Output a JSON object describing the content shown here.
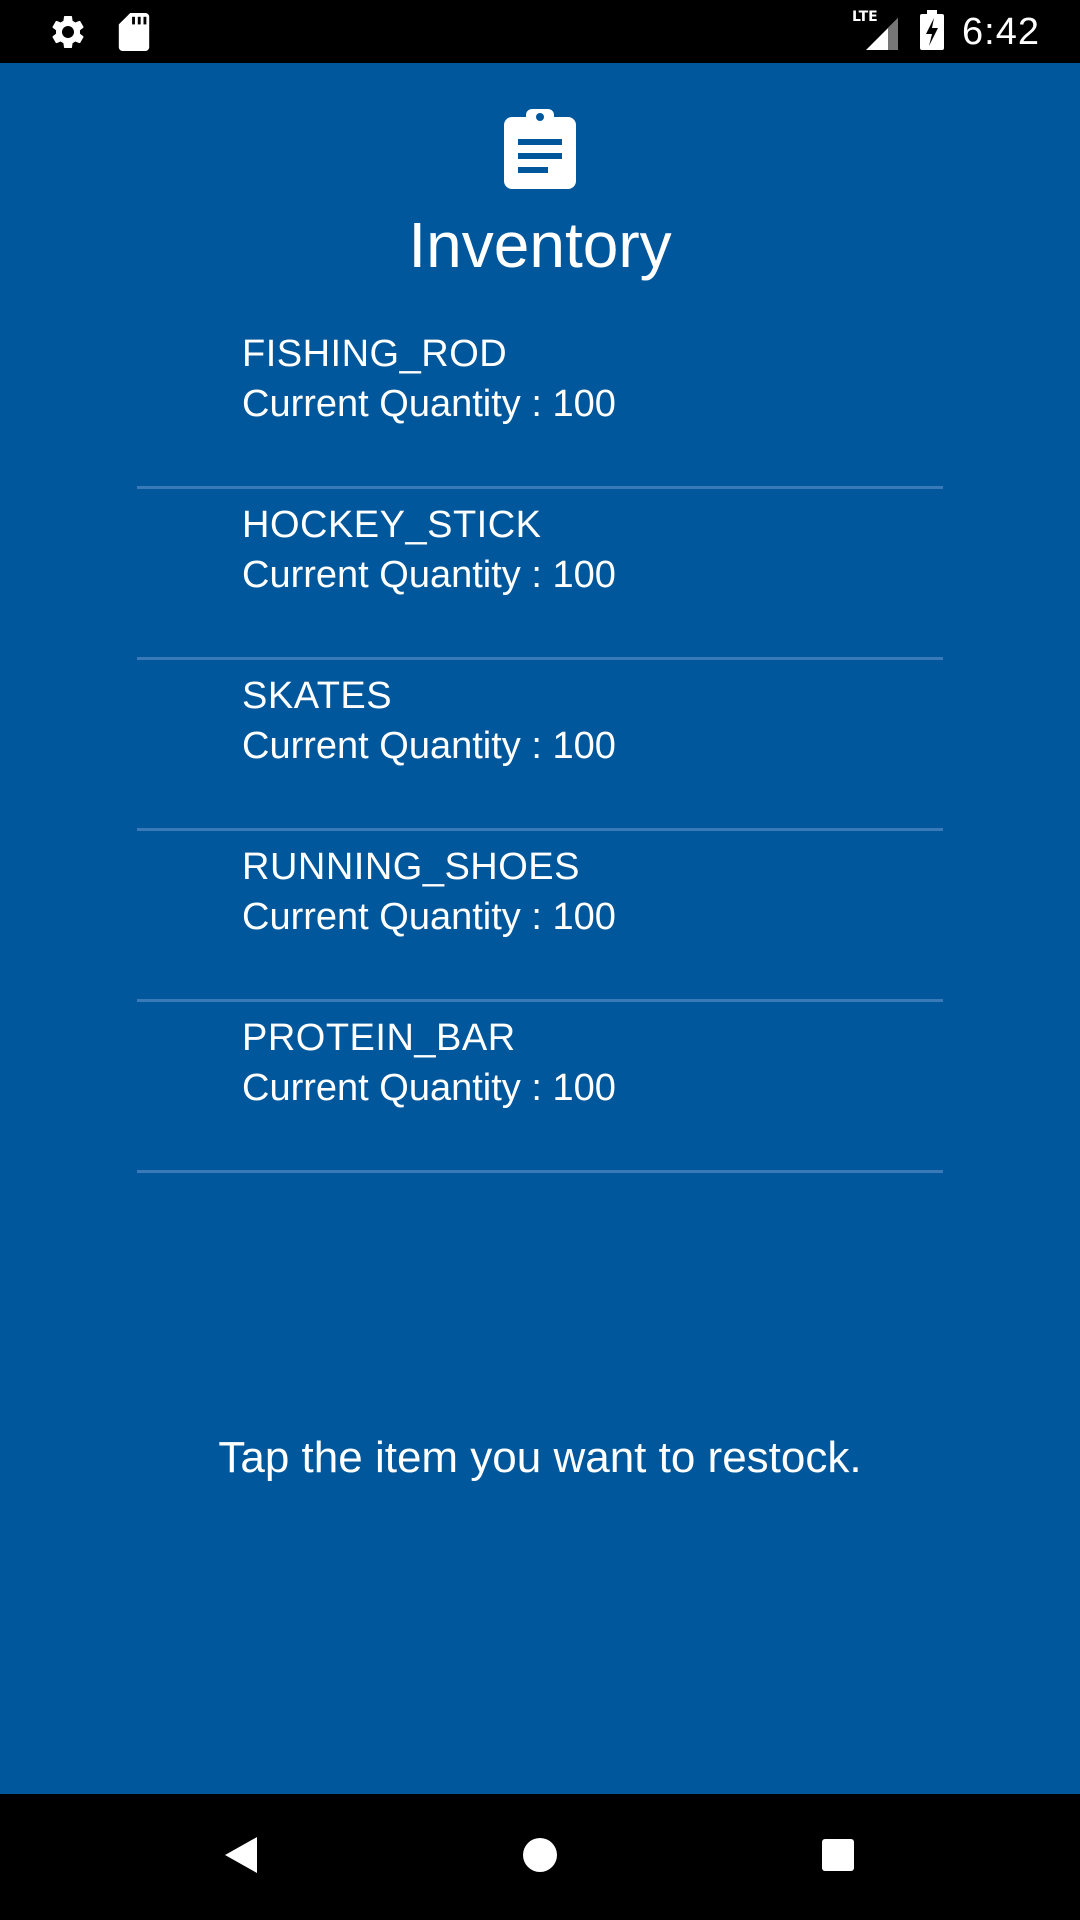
{
  "status_bar": {
    "time": "6:42",
    "network": "LTE",
    "icons": [
      "gear-icon",
      "sd-card-icon",
      "lte-signal-icon",
      "battery-charging-icon"
    ]
  },
  "header": {
    "icon": "clipboard-icon",
    "title": "Inventory"
  },
  "inventory": {
    "items": [
      {
        "name": "FISHING_ROD",
        "quantity_text": "Current Quantity : 100"
      },
      {
        "name": "HOCKEY_STICK",
        "quantity_text": "Current Quantity : 100"
      },
      {
        "name": "SKATES",
        "quantity_text": "Current Quantity : 100"
      },
      {
        "name": "RUNNING_SHOES",
        "quantity_text": "Current Quantity : 100"
      },
      {
        "name": "PROTEIN_BAR",
        "quantity_text": "Current Quantity : 100"
      }
    ]
  },
  "hint": "Tap the item you want to restock.",
  "nav_bar": {
    "buttons": [
      "back-icon",
      "home-icon",
      "recents-icon"
    ]
  },
  "colors": {
    "background": "#01579b",
    "divider": "#3b7ab8",
    "text": "#ffffff",
    "system_bars": "#000000"
  }
}
